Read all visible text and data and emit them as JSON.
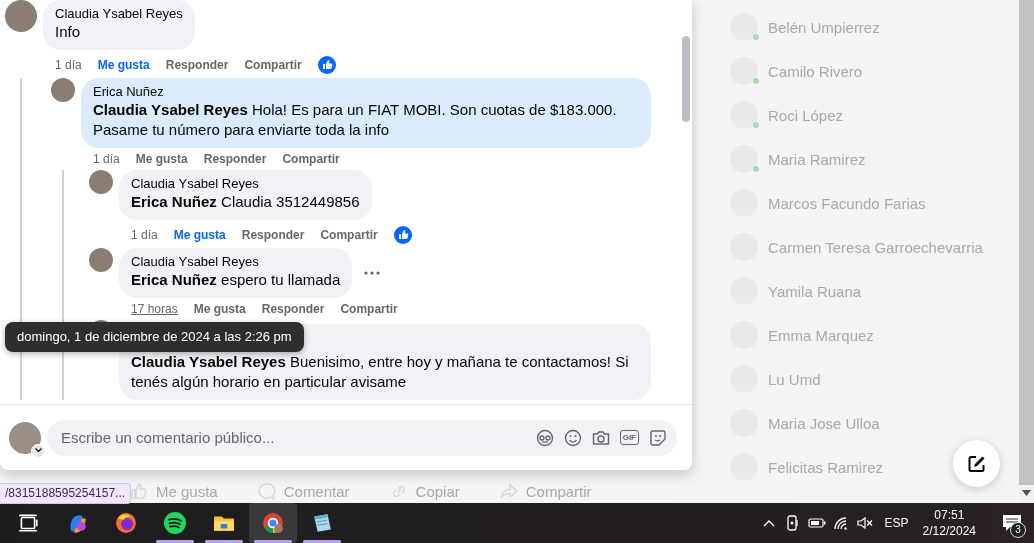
{
  "comments": [
    {
      "author": "Claudia Ysabel Reyes",
      "text": "Info",
      "time": "1 día",
      "like": "Me gusta",
      "reply": "Responder",
      "share": "Compartir",
      "liked": true,
      "highlighted": false,
      "time_hovered": false,
      "more_shown": false,
      "children": [
        {
          "author": "Erica Nuñez",
          "text": "**Claudia Ysabel Reyes** Hola! Es para un FIAT MOBI. Son cuotas de $183.000. Pasame tu número para enviarte toda la info",
          "time": "1 día",
          "like": "Me gusta",
          "reply": "Responder",
          "share": "Compartir",
          "liked": false,
          "highlighted": true,
          "time_hovered": false,
          "more_shown": false,
          "children": [
            {
              "author": "Claudia Ysabel Reyes",
              "text": "**Erica Nuñez** Claudia 3512449856",
              "time": "1 día",
              "like": "Me gusta",
              "reply": "Responder",
              "share": "Compartir",
              "liked": true,
              "highlighted": false,
              "time_hovered": false,
              "more_shown": false
            },
            {
              "author": "Claudia Ysabel Reyes",
              "text": "**Erica Nuñez** espero tu llamada",
              "time": "17 horas",
              "like": "Me gusta",
              "reply": "Responder",
              "share": "Compartir",
              "liked": false,
              "highlighted": false,
              "time_hovered": true,
              "more_shown": true
            },
            {
              "text": "**Claudia Ysabel Reyes** Buenisimo, entre hoy y mañana te contactamos! Si tenés algún horario en particular avisame",
              "highlighted": false,
              "more_shown": false
            }
          ]
        }
      ]
    }
  ],
  "tooltip": "domingo, 1 de diciembre de 2024 a las 2:26 pm",
  "composer": {
    "placeholder": "Escribe un comentario público...",
    "gif_label": "GIF"
  },
  "post_actions": [
    {
      "kind": "like",
      "label": "Me gusta"
    },
    {
      "kind": "comment",
      "label": "Comentar"
    },
    {
      "kind": "copy",
      "label": "Copiar"
    },
    {
      "kind": "share",
      "label": "Compartir"
    }
  ],
  "status_url": "/8315188595254157...",
  "contacts": [
    {
      "name": "Belén Umpierrez",
      "online": true
    },
    {
      "name": "Camilo Rivero",
      "online": true
    },
    {
      "name": "Roci López",
      "online": true
    },
    {
      "name": "Maria Ramirez",
      "online": true
    },
    {
      "name": "Marcos Facundo Farias",
      "online": false
    },
    {
      "name": "Carmen Teresa Garroechevarria",
      "online": false
    },
    {
      "name": "Yamila Ruana",
      "online": false
    },
    {
      "name": "Emma Marquez",
      "online": false
    },
    {
      "name": "Lu Umd",
      "online": false
    },
    {
      "name": "Maria Jose Ulloa",
      "online": false
    },
    {
      "name": "Felicitas Ramirez",
      "online": false
    }
  ],
  "taskbar": {
    "apps": [
      {
        "kind": "taskview",
        "running": false,
        "active": false
      },
      {
        "kind": "swirl",
        "running": false,
        "active": false
      },
      {
        "kind": "fox",
        "running": false,
        "active": false
      },
      {
        "kind": "waves",
        "running": true,
        "active": false
      },
      {
        "kind": "folder",
        "running": true,
        "active": false
      },
      {
        "kind": "browser",
        "running": true,
        "active": true
      },
      {
        "kind": "notepad",
        "running": true,
        "active": false
      }
    ],
    "language": "ESP",
    "time": "07:51",
    "date": "2/12/2024",
    "notifications": "3"
  }
}
